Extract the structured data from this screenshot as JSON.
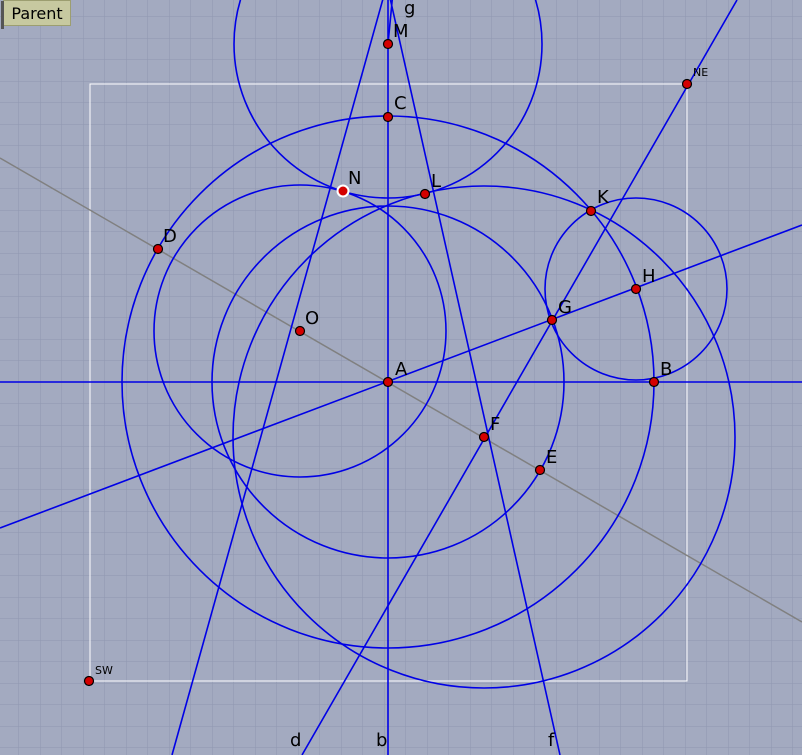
{
  "toolbar": {
    "parent_label": "Parent"
  },
  "colors": {
    "background": "#a3aac0",
    "grid": "#8f97b0",
    "construction": "#0000e6",
    "auxiliary_line": "#808080",
    "frame": "#ffffff",
    "point_fill": "#d40000"
  },
  "points": [
    {
      "name": "A",
      "label": "A"
    },
    {
      "name": "B",
      "label": "B"
    },
    {
      "name": "C",
      "label": "C"
    },
    {
      "name": "D",
      "label": "D"
    },
    {
      "name": "E",
      "label": "E"
    },
    {
      "name": "F",
      "label": "F"
    },
    {
      "name": "G",
      "label": "G"
    },
    {
      "name": "H",
      "label": "H"
    },
    {
      "name": "K",
      "label": "K"
    },
    {
      "name": "L",
      "label": "L"
    },
    {
      "name": "M",
      "label": "M"
    },
    {
      "name": "N",
      "label": "N",
      "style": "selected"
    },
    {
      "name": "O",
      "label": "O"
    },
    {
      "name": "NE",
      "label": "NE"
    },
    {
      "name": "SW",
      "label": "SW"
    }
  ],
  "line_labels": [
    "g",
    "d",
    "b",
    "f"
  ]
}
